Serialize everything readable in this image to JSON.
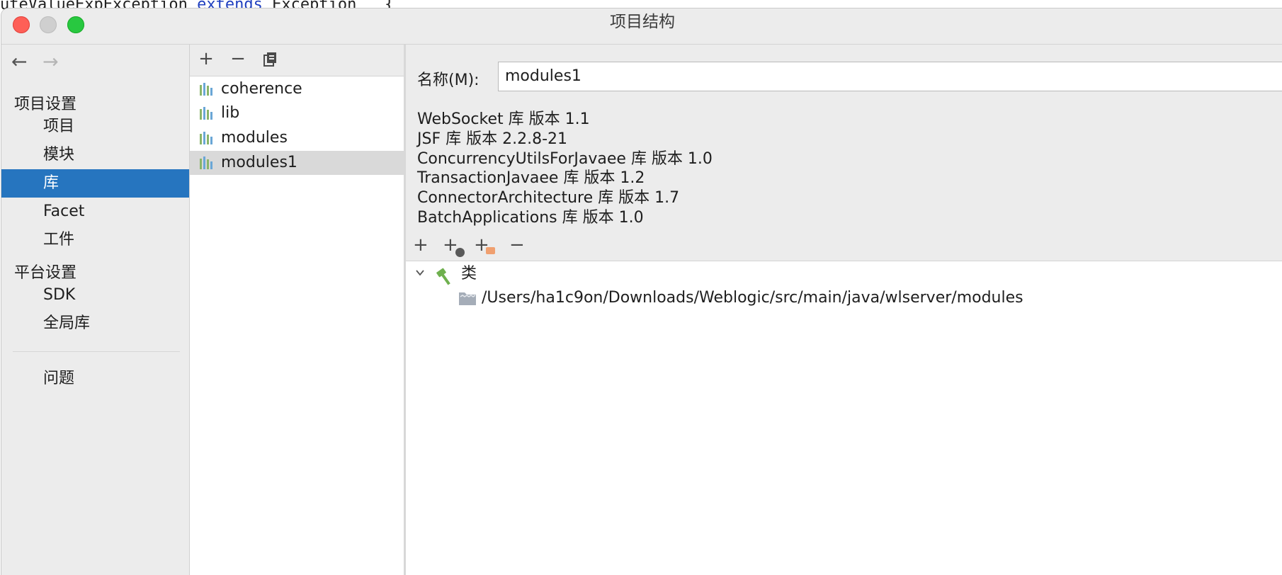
{
  "background_editor": {
    "line_prefix": "uteValueExpException ",
    "keyword": "extends",
    "line_suffix": " Exception   {"
  },
  "window": {
    "title": "项目结构"
  },
  "sidebar": {
    "nav_back": "←",
    "nav_forward": "→",
    "project_settings_heading": "项目设置",
    "project_items": [
      "项目",
      "模块",
      "库",
      "Facet",
      "工件"
    ],
    "selected_item": "库",
    "platform_settings_heading": "平台设置",
    "platform_items": [
      "SDK",
      "全局库"
    ],
    "problems_item": "问题"
  },
  "library_list": {
    "toolbar": {
      "add": "+",
      "remove": "−",
      "copy_icon": "copy-icon"
    },
    "items": [
      "coherence",
      "lib",
      "modules",
      "modules1"
    ],
    "selected": "modules1"
  },
  "detail": {
    "name_label": "名称(M):",
    "name_value": "modules1",
    "dependencies": [
      "WebSocket 库  版本 1.1",
      "JSF 库  版本 2.2.8-21",
      "ConcurrencyUtilsForJavaee 库  版本 1.0",
      "TransactionJavaee 库  版本 1.2",
      "ConnectorArchitecture 库  版本 1.7",
      "BatchApplications 库  版本 1.0"
    ],
    "toolbar": {
      "add": "+",
      "add_url": "+",
      "add_folder": "+",
      "remove": "−"
    },
    "tree": {
      "root_label": "类",
      "root_icon": "hammer-icon",
      "child_path": "/Users/ha1c9on/Downloads/Weblogic/src/main/java/wlserver/modules",
      "child_icon": "folder-icon"
    }
  },
  "colors": {
    "selection_blue": "#2675bf",
    "window_bg": "#ececec",
    "list_selection": "#d9d9d9",
    "close": "#fe5f57",
    "maximize": "#28c840"
  }
}
